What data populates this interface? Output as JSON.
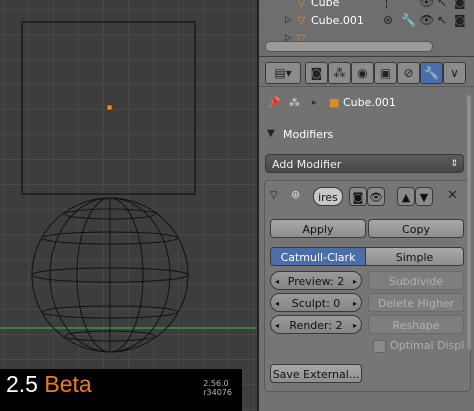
{
  "outliner": {
    "rows": [
      {
        "label": "Cube"
      },
      {
        "label": "Cube.001"
      },
      {
        "label": ""
      }
    ]
  },
  "properties": {
    "breadcrumb": "Cube.001",
    "panel_title": "Modifiers",
    "add_modifier": "Add Modifier",
    "modifier_name": "ires",
    "apply": "Apply",
    "copy": "Copy",
    "catmull_clark": "Catmull-Clark",
    "simple": "Simple",
    "preview": "Preview: 2",
    "sculpt": "Sculpt: 0",
    "render": "Render: 2",
    "subdivide": "Subdivide",
    "delete_higher": "Delete Higher",
    "reshape": "Reshape",
    "optimal_display": "Optimal Displ",
    "save_external": "Save External..."
  },
  "splash": {
    "version_num": "2.5",
    "version_tag": "Beta",
    "build": "2.56.0",
    "revision": "r34076"
  },
  "colors": {
    "accent": "#4b6ea8",
    "splash_orange": "#f07d1a",
    "object_origin": "#f08a1a",
    "axis_green": "#3da83d"
  }
}
